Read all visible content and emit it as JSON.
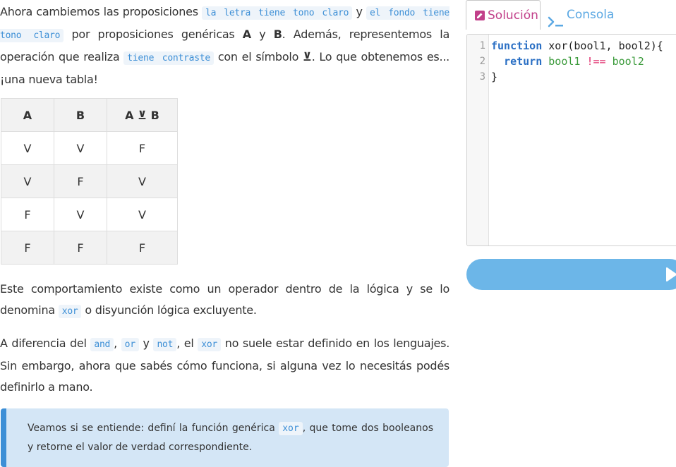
{
  "content": {
    "p1": {
      "t1": "Ahora cambiemos las proposiciones ",
      "c1": "la letra tiene tono claro",
      "t2": " y ",
      "c2": "el fondo tiene tono claro",
      "t3": " por proposiciones genéricas ",
      "b1": "A",
      "t4": " y ",
      "b2": "B",
      "t5": ". Además, representemos la operación que realiza ",
      "c3": "tiene contraste",
      "t6": " con el símbolo ",
      "b3": "⊻",
      "t7": ". Lo que obtenemos es... ¡una nueva tabla!"
    },
    "truth_table": {
      "headers": [
        "A",
        "B",
        "A ⊻ B"
      ],
      "rows": [
        [
          "V",
          "V",
          "F"
        ],
        [
          "V",
          "F",
          "V"
        ],
        [
          "F",
          "V",
          "V"
        ],
        [
          "F",
          "F",
          "F"
        ]
      ]
    },
    "p2": {
      "t1": "Este comportamiento existe como un operador dentro de la lógica y se lo denomina ",
      "c1": "xor",
      "t2": " o disyunción lógica excluyente."
    },
    "p3": {
      "t1": "A diferencia del ",
      "c1": "and",
      "t2": ", ",
      "c2": "or",
      "t3": " y ",
      "c3": "not",
      "t4": ", el ",
      "c4": "xor",
      "t5": " no suele estar definido en los lenguajes. Sin embargo, ahora que sabés cómo funciona, si alguna vez lo necesitás podés definirlo a mano."
    },
    "callout": {
      "t1": "Veamos si se entiende: definí la función genérica ",
      "c1": "xor",
      "t2": ", que tome dos booleanos y retorne el valor de verdad correspondiente."
    }
  },
  "tabs": {
    "solution": {
      "label": "Solución",
      "icon": "pencil-icon"
    },
    "console": {
      "label": "Consola",
      "icon": "terminal-icon"
    }
  },
  "editor": {
    "line_numbers": [
      "1",
      "2",
      "3"
    ],
    "line1": {
      "kw": "function",
      "rest": " xor(bool1, bool2){"
    },
    "line2": {
      "indent": "  ",
      "kw": "return",
      "v1": "bool1",
      "op": "!==",
      "v2": "bool2"
    },
    "line3": {
      "text": "}"
    }
  },
  "run_button": {
    "icon": "play-icon"
  },
  "colors": {
    "accent_blue": "#3d8fd6",
    "solution_tab": "#c2408a",
    "console_tab": "#5ba8e3",
    "callout_bg": "#d4e6f6",
    "run_button": "#6cb6e8"
  }
}
